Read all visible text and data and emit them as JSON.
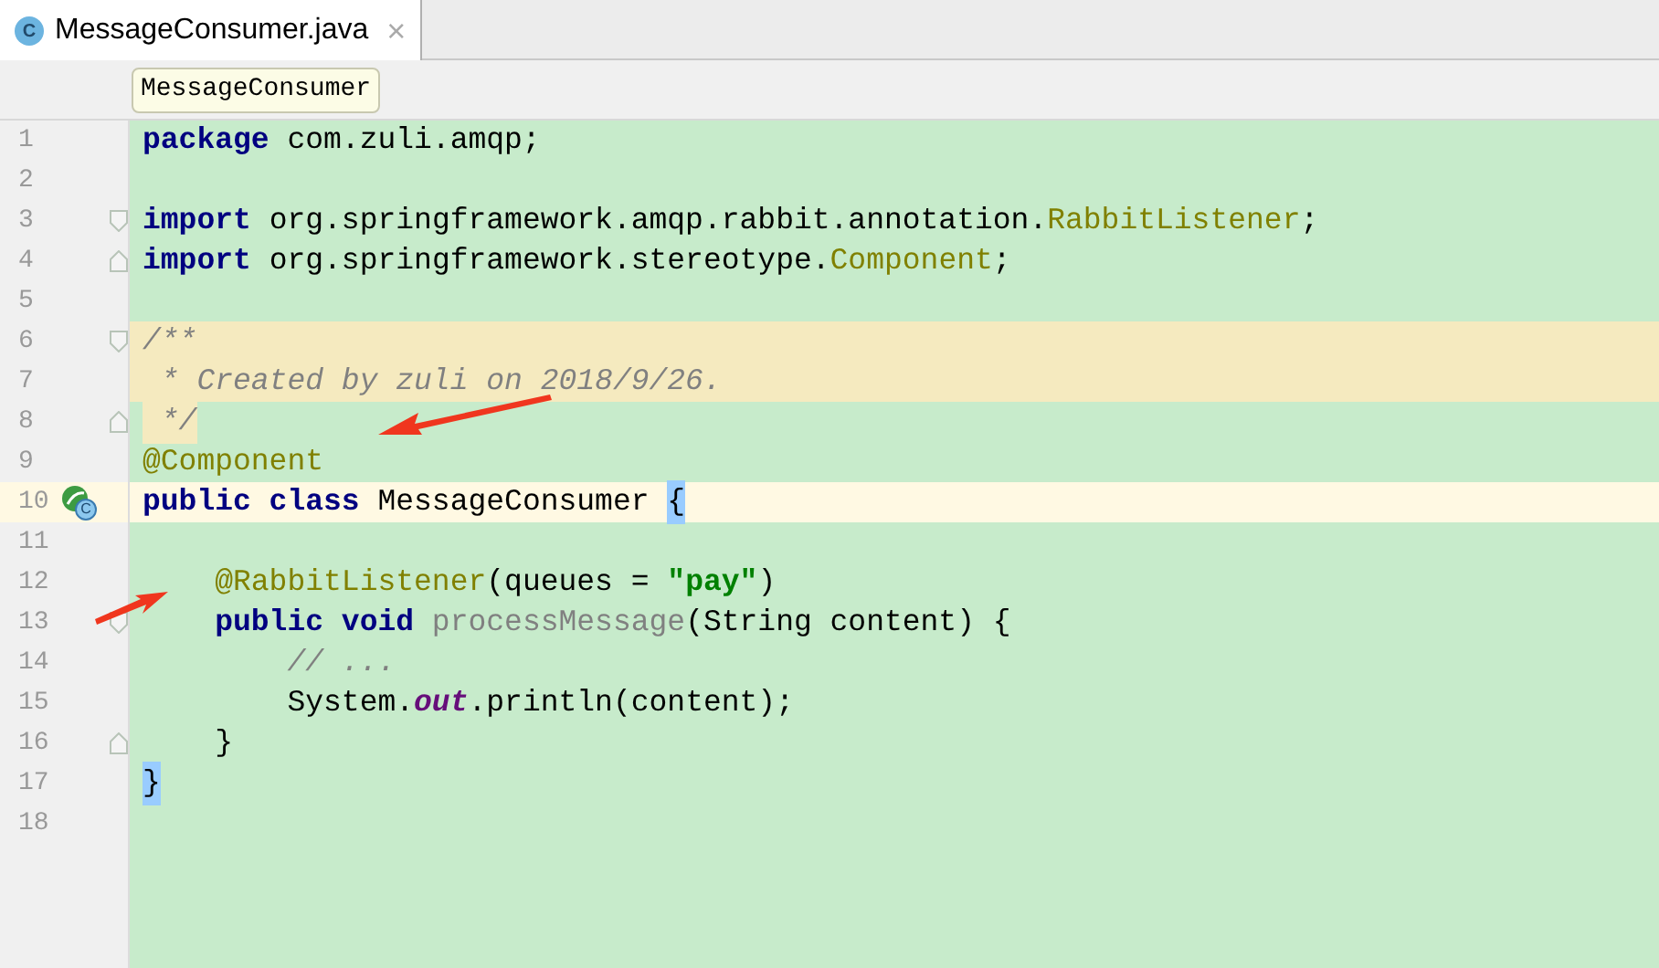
{
  "tab": {
    "title": "MessageConsumer.java",
    "icon": "C",
    "close": "×",
    "selected": true
  },
  "breadcrumb": "MessageConsumer",
  "lines": [
    {
      "number": "1",
      "doc_comment": false,
      "caret_line": false,
      "fold_start": false,
      "fold_end": false,
      "segments": [
        {
          "kind": "keyword",
          "text": "package"
        },
        {
          "kind": "plain",
          "text": " com.zuli.amqp;"
        }
      ]
    },
    {
      "number": "2",
      "doc_comment": false,
      "caret_line": false,
      "fold_start": false,
      "fold_end": false
    },
    {
      "number": "3",
      "doc_comment": false,
      "caret_line": false,
      "fold_start": true,
      "fold_end": false,
      "segments": [
        {
          "kind": "keyword",
          "text": "import"
        },
        {
          "kind": "plain",
          "text": " org.springframework.amqp.rabbit.annotation."
        },
        {
          "kind": "annotation",
          "text": "RabbitListener"
        },
        {
          "kind": "plain",
          "text": ";"
        }
      ]
    },
    {
      "number": "4",
      "doc_comment": false,
      "caret_line": false,
      "fold_start": false,
      "fold_end": true,
      "segments": [
        {
          "kind": "keyword",
          "text": "import"
        },
        {
          "kind": "plain",
          "text": " org.springframework.stereotype."
        },
        {
          "kind": "annotation",
          "text": "Component"
        },
        {
          "kind": "plain",
          "text": ";"
        }
      ]
    },
    {
      "number": "5",
      "doc_comment": false,
      "caret_line": false,
      "fold_start": false,
      "fold_end": false
    },
    {
      "number": "6",
      "doc_comment": true,
      "caret_line": false,
      "fold_start": true,
      "fold_end": false,
      "segments": [
        {
          "kind": "comment",
          "text": "/**"
        }
      ]
    },
    {
      "number": "7",
      "doc_comment": true,
      "caret_line": false,
      "fold_start": false,
      "fold_end": false,
      "segments": [
        {
          "kind": "comment",
          "text": " * Created by zuli on 2018/9/26."
        }
      ]
    },
    {
      "number": "8",
      "doc_comment": false,
      "caret_line": false,
      "fold_start": false,
      "fold_end": true,
      "segments": [
        {
          "kind": "doc-comment",
          "text": " */"
        }
      ]
    },
    {
      "number": "9",
      "doc_comment": false,
      "caret_line": false,
      "fold_start": false,
      "fold_end": false,
      "segments": [
        {
          "kind": "annotation",
          "text": "@Component"
        }
      ]
    },
    {
      "number": "10",
      "doc_comment": false,
      "caret_line": true,
      "fold_start": false,
      "fold_end": false,
      "gutter_icon": "C",
      "segments": [
        {
          "kind": "keyword",
          "text": "public class"
        },
        {
          "kind": "plain",
          "text": " MessageConsumer "
        },
        {
          "kind": "brace",
          "text": "{"
        }
      ]
    },
    {
      "number": "11",
      "doc_comment": false,
      "caret_line": false,
      "fold_start": false,
      "fold_end": false
    },
    {
      "number": "12",
      "doc_comment": false,
      "caret_line": false,
      "fold_start": false,
      "fold_end": false,
      "segments": [
        {
          "kind": "annotation",
          "text": "    @RabbitListener"
        },
        {
          "kind": "plain",
          "text": "(queues = "
        },
        {
          "kind": "string",
          "text": "\"pay\""
        },
        {
          "kind": "plain",
          "text": ")"
        }
      ]
    },
    {
      "number": "13",
      "doc_comment": false,
      "caret_line": false,
      "fold_start": true,
      "fold_end": false,
      "segments": [
        {
          "kind": "keyword",
          "text": "    public void"
        },
        {
          "kind": "unused",
          "text": " processMessage"
        },
        {
          "kind": "plain",
          "text": "(String content) {"
        }
      ]
    },
    {
      "number": "14",
      "doc_comment": false,
      "caret_line": false,
      "fold_start": false,
      "fold_end": false,
      "segments": [
        {
          "kind": "comment",
          "text": "        // ..."
        }
      ]
    },
    {
      "number": "15",
      "doc_comment": false,
      "caret_line": false,
      "fold_start": false,
      "fold_end": false,
      "segments": [
        {
          "kind": "plain",
          "text": "        System."
        },
        {
          "kind": "field",
          "text": "out"
        },
        {
          "kind": "plain",
          "text": ".println(content);"
        }
      ]
    },
    {
      "number": "16",
      "doc_comment": false,
      "caret_line": false,
      "fold_start": false,
      "fold_end": true,
      "segments": [
        {
          "kind": "plain",
          "text": "    }"
        }
      ]
    },
    {
      "number": "17",
      "doc_comment": false,
      "caret_line": false,
      "fold_start": false,
      "fold_end": false,
      "segments": [
        {
          "kind": "brace",
          "text": "}"
        }
      ]
    },
    {
      "number": "18",
      "doc_comment": false,
      "caret_line": false,
      "fold_start": false,
      "fold_end": false
    }
  ]
}
